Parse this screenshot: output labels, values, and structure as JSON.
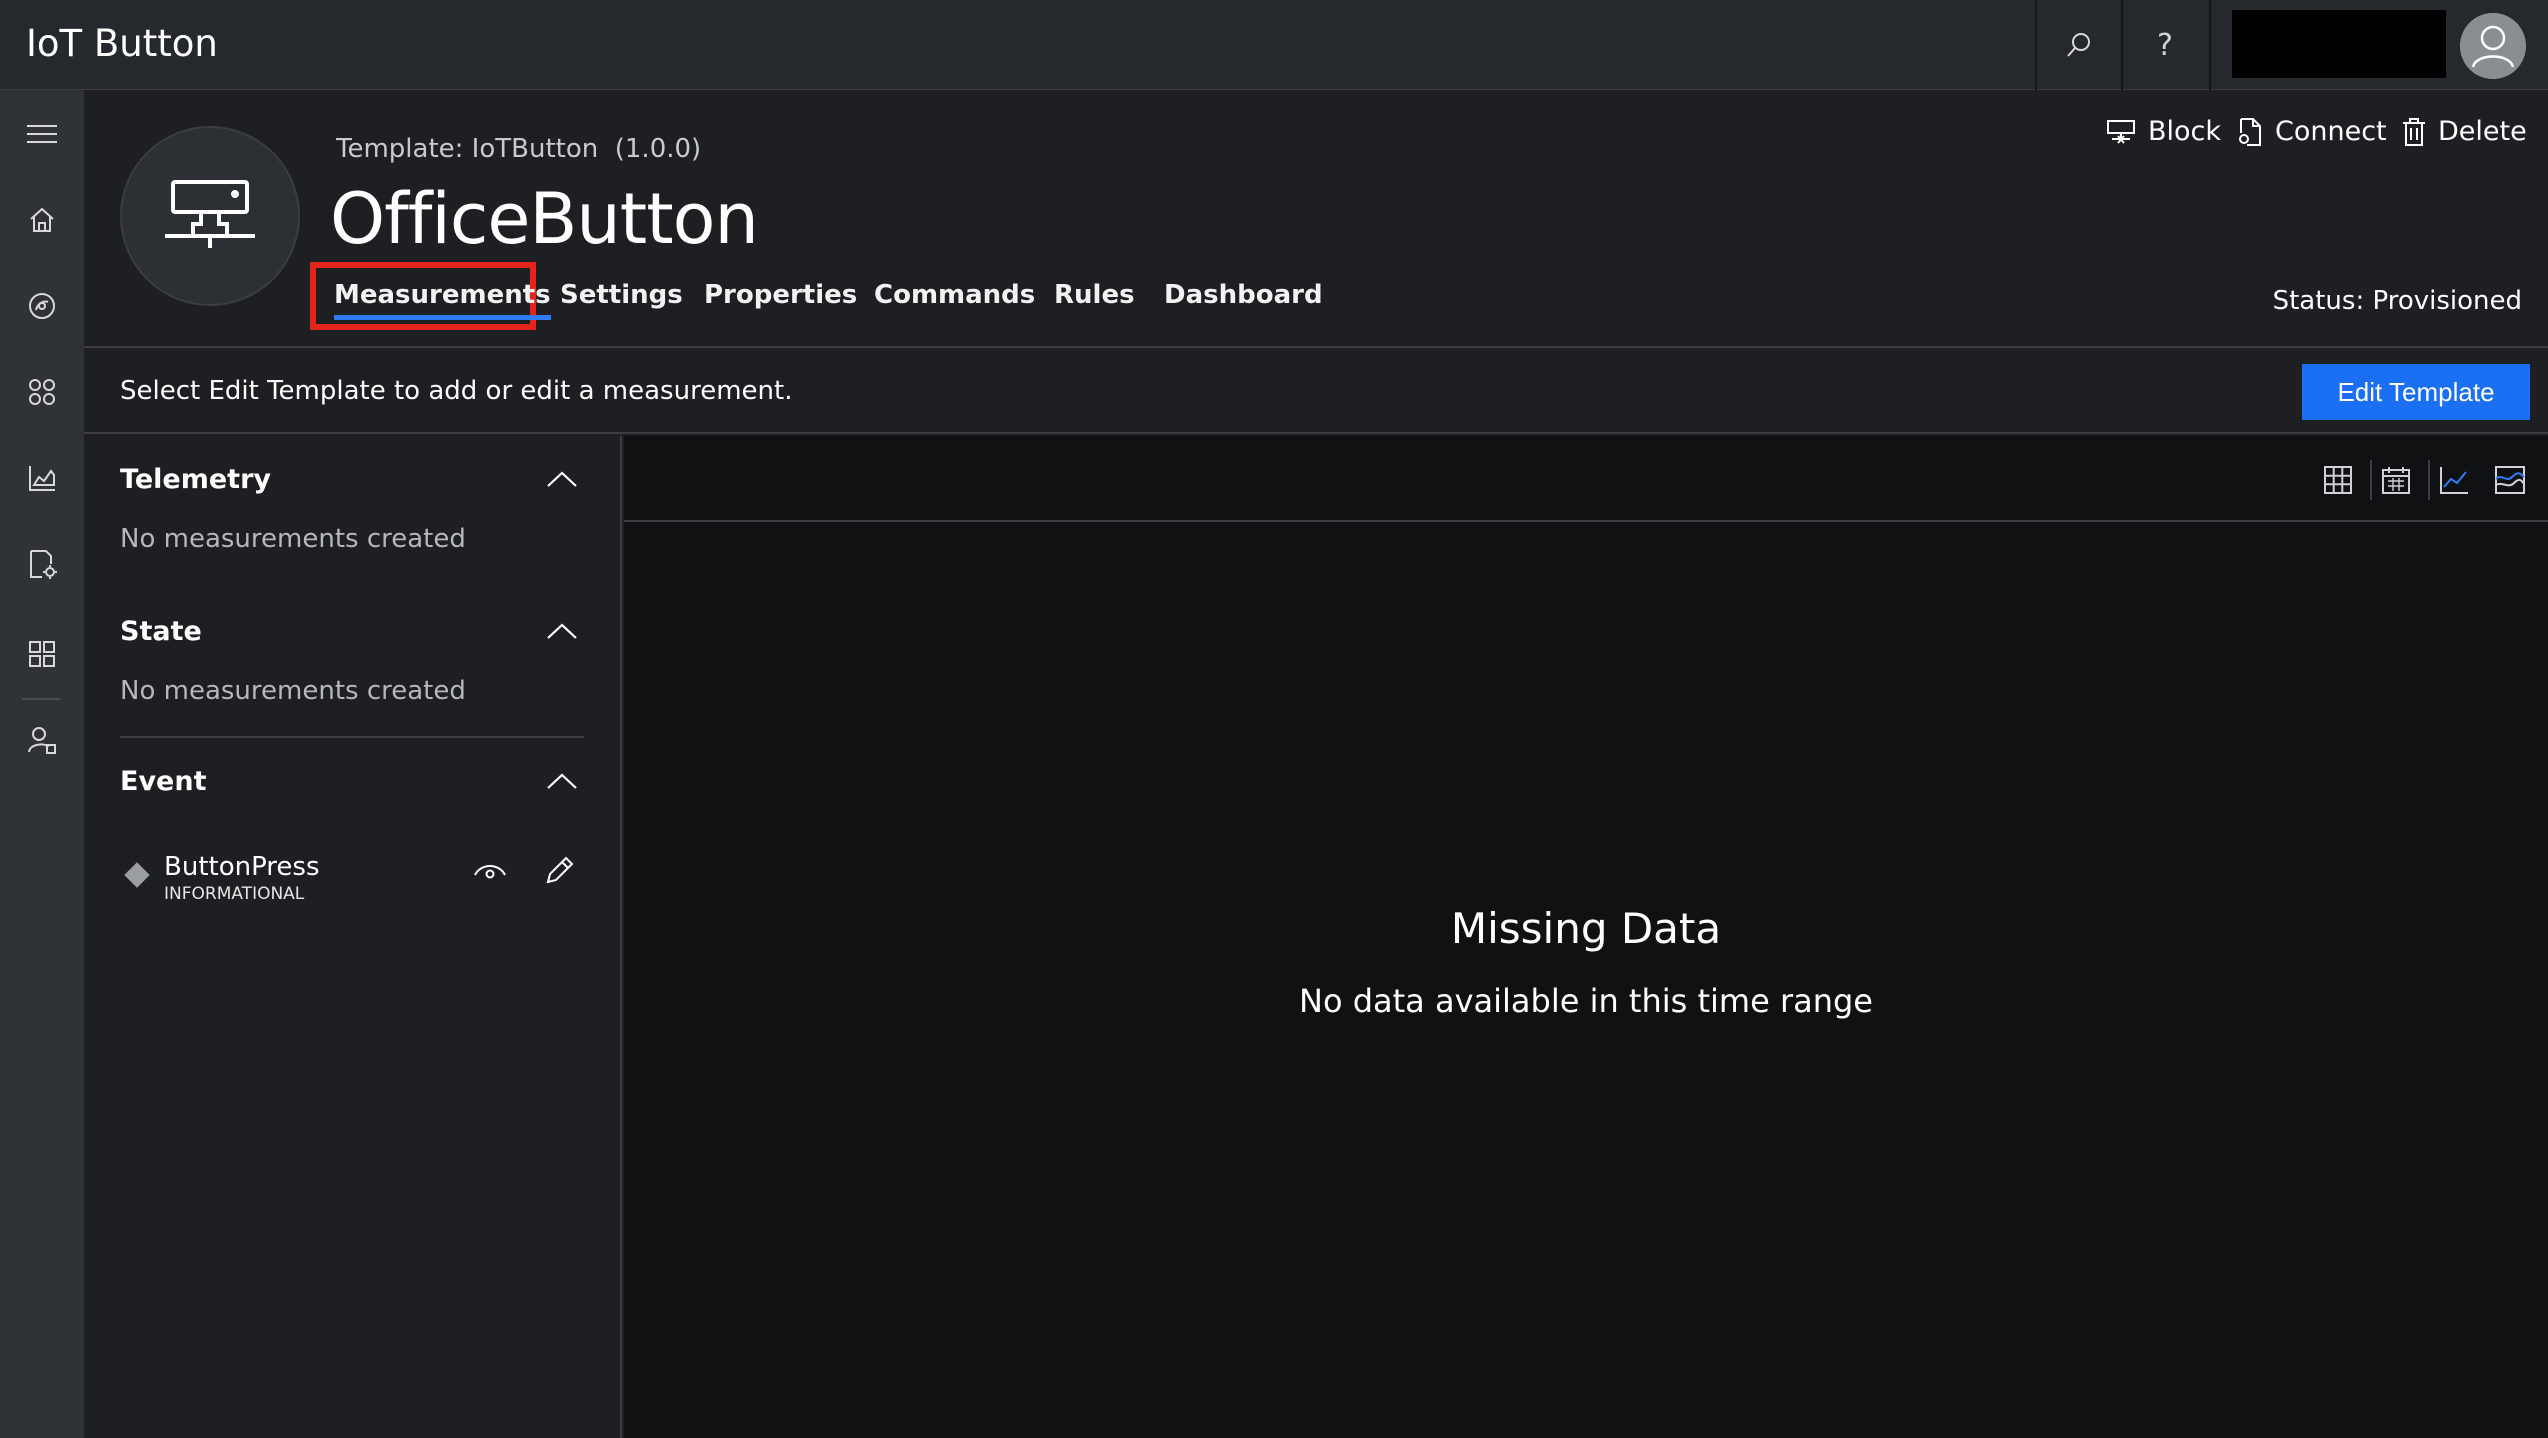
{
  "app": {
    "title": "IoT Button"
  },
  "topbar": {
    "search_icon": "search-icon",
    "help_label": "?",
    "avatar_icon": "user-avatar-icon"
  },
  "leftnav": {
    "items": [
      {
        "icon": "hamburger-menu-icon"
      },
      {
        "icon": "home-icon"
      },
      {
        "icon": "device-explorer-icon"
      },
      {
        "icon": "device-sets-icon"
      },
      {
        "icon": "analytics-icon"
      },
      {
        "icon": "jobs-icon"
      },
      {
        "icon": "device-templates-icon"
      },
      {
        "icon": "administration-icon"
      }
    ]
  },
  "device": {
    "template_prefix": "Template:",
    "template_name": "IoTButton",
    "template_version": "(1.0.0)",
    "name": "OfficeButton",
    "status_label": "Status:",
    "status_value": "Provisioned"
  },
  "tabs": [
    {
      "label": "Measurements",
      "active": true
    },
    {
      "label": "Settings"
    },
    {
      "label": "Properties"
    },
    {
      "label": "Commands"
    },
    {
      "label": "Rules"
    },
    {
      "label": "Dashboard"
    }
  ],
  "actions": {
    "block_label": "Block",
    "connect_label": "Connect",
    "delete_label": "Delete"
  },
  "infobar": {
    "message": "Select Edit Template to add or edit a measurement.",
    "edit_template_label": "Edit Template"
  },
  "measurements": {
    "telemetry": {
      "title": "Telemetry",
      "empty": "No measurements created"
    },
    "state": {
      "title": "State",
      "empty": "No measurements created"
    },
    "event": {
      "title": "Event",
      "items": [
        {
          "name": "ButtonPress",
          "severity": "INFORMATIONAL"
        }
      ]
    }
  },
  "chart": {
    "views": [
      "grid-view-icon",
      "calendar-icon",
      "line-chart-icon",
      "area-chart-icon"
    ],
    "empty_title": "Missing Data",
    "empty_subtitle": "No data available in this time range"
  },
  "colors": {
    "accent": "#1b6ff2",
    "highlight_box": "#e4231c",
    "active_tab_underline": "#2f7cf6"
  }
}
